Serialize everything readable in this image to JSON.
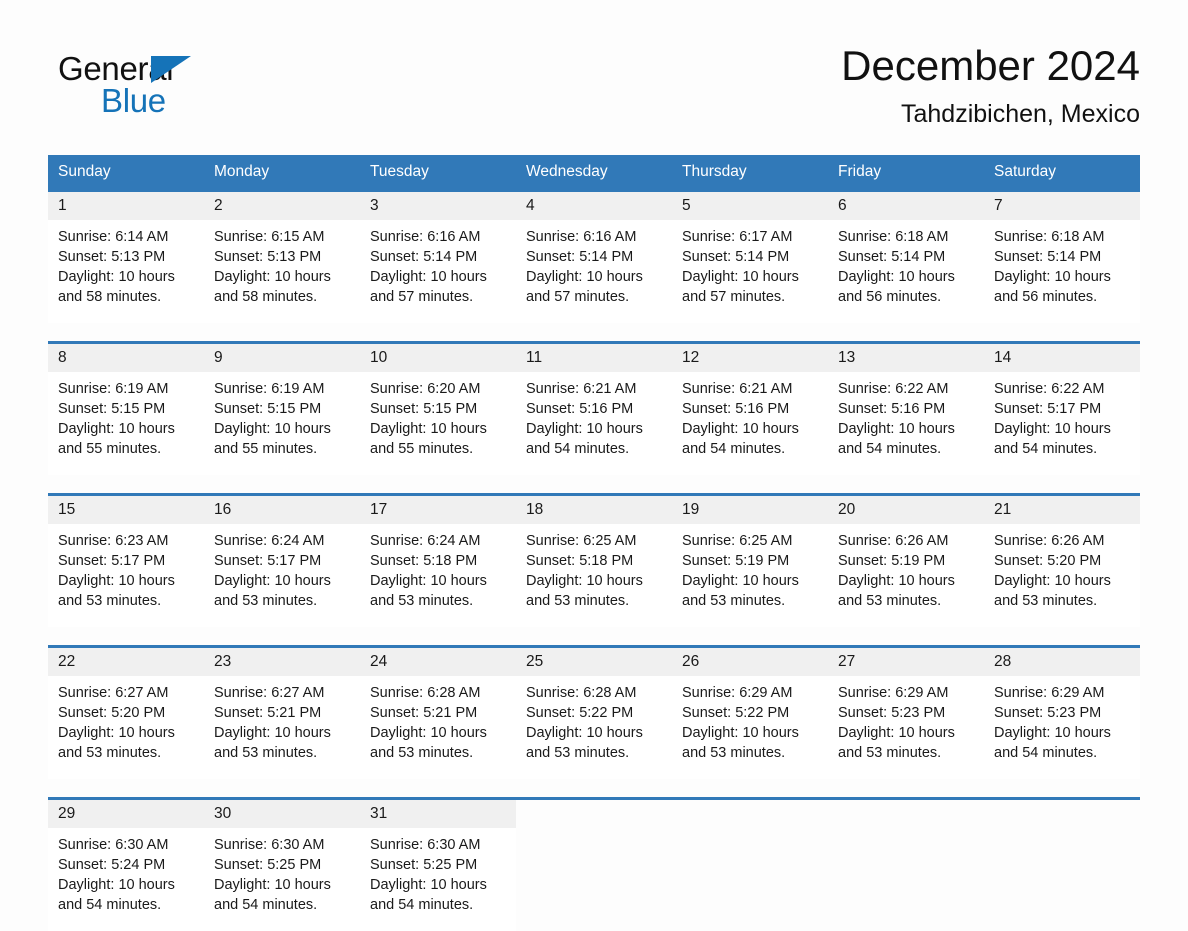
{
  "brand": {
    "word_one": "General",
    "word_two": "Blue",
    "triangle_icon": "brand-triangle-icon",
    "accent_color": "#1573b8"
  },
  "header": {
    "month_title": "December 2024",
    "location": "Tahdzibichen, Mexico"
  },
  "theme": {
    "header_blue": "#3179b8",
    "daynum_band": "#f0f0f0",
    "page_bg": "#fdfdfd",
    "text": "#1a1a1a"
  },
  "calendar": {
    "weekday_headers": [
      "Sunday",
      "Monday",
      "Tuesday",
      "Wednesday",
      "Thursday",
      "Friday",
      "Saturday"
    ],
    "weeks": [
      [
        {
          "day": "1",
          "sunrise": "Sunrise: 6:14 AM",
          "sunset": "Sunset: 5:13 PM",
          "daylight_l1": "Daylight: 10 hours",
          "daylight_l2": "and 58 minutes."
        },
        {
          "day": "2",
          "sunrise": "Sunrise: 6:15 AM",
          "sunset": "Sunset: 5:13 PM",
          "daylight_l1": "Daylight: 10 hours",
          "daylight_l2": "and 58 minutes."
        },
        {
          "day": "3",
          "sunrise": "Sunrise: 6:16 AM",
          "sunset": "Sunset: 5:14 PM",
          "daylight_l1": "Daylight: 10 hours",
          "daylight_l2": "and 57 minutes."
        },
        {
          "day": "4",
          "sunrise": "Sunrise: 6:16 AM",
          "sunset": "Sunset: 5:14 PM",
          "daylight_l1": "Daylight: 10 hours",
          "daylight_l2": "and 57 minutes."
        },
        {
          "day": "5",
          "sunrise": "Sunrise: 6:17 AM",
          "sunset": "Sunset: 5:14 PM",
          "daylight_l1": "Daylight: 10 hours",
          "daylight_l2": "and 57 minutes."
        },
        {
          "day": "6",
          "sunrise": "Sunrise: 6:18 AM",
          "sunset": "Sunset: 5:14 PM",
          "daylight_l1": "Daylight: 10 hours",
          "daylight_l2": "and 56 minutes."
        },
        {
          "day": "7",
          "sunrise": "Sunrise: 6:18 AM",
          "sunset": "Sunset: 5:14 PM",
          "daylight_l1": "Daylight: 10 hours",
          "daylight_l2": "and 56 minutes."
        }
      ],
      [
        {
          "day": "8",
          "sunrise": "Sunrise: 6:19 AM",
          "sunset": "Sunset: 5:15 PM",
          "daylight_l1": "Daylight: 10 hours",
          "daylight_l2": "and 55 minutes."
        },
        {
          "day": "9",
          "sunrise": "Sunrise: 6:19 AM",
          "sunset": "Sunset: 5:15 PM",
          "daylight_l1": "Daylight: 10 hours",
          "daylight_l2": "and 55 minutes."
        },
        {
          "day": "10",
          "sunrise": "Sunrise: 6:20 AM",
          "sunset": "Sunset: 5:15 PM",
          "daylight_l1": "Daylight: 10 hours",
          "daylight_l2": "and 55 minutes."
        },
        {
          "day": "11",
          "sunrise": "Sunrise: 6:21 AM",
          "sunset": "Sunset: 5:16 PM",
          "daylight_l1": "Daylight: 10 hours",
          "daylight_l2": "and 54 minutes."
        },
        {
          "day": "12",
          "sunrise": "Sunrise: 6:21 AM",
          "sunset": "Sunset: 5:16 PM",
          "daylight_l1": "Daylight: 10 hours",
          "daylight_l2": "and 54 minutes."
        },
        {
          "day": "13",
          "sunrise": "Sunrise: 6:22 AM",
          "sunset": "Sunset: 5:16 PM",
          "daylight_l1": "Daylight: 10 hours",
          "daylight_l2": "and 54 minutes."
        },
        {
          "day": "14",
          "sunrise": "Sunrise: 6:22 AM",
          "sunset": "Sunset: 5:17 PM",
          "daylight_l1": "Daylight: 10 hours",
          "daylight_l2": "and 54 minutes."
        }
      ],
      [
        {
          "day": "15",
          "sunrise": "Sunrise: 6:23 AM",
          "sunset": "Sunset: 5:17 PM",
          "daylight_l1": "Daylight: 10 hours",
          "daylight_l2": "and 53 minutes."
        },
        {
          "day": "16",
          "sunrise": "Sunrise: 6:24 AM",
          "sunset": "Sunset: 5:17 PM",
          "daylight_l1": "Daylight: 10 hours",
          "daylight_l2": "and 53 minutes."
        },
        {
          "day": "17",
          "sunrise": "Sunrise: 6:24 AM",
          "sunset": "Sunset: 5:18 PM",
          "daylight_l1": "Daylight: 10 hours",
          "daylight_l2": "and 53 minutes."
        },
        {
          "day": "18",
          "sunrise": "Sunrise: 6:25 AM",
          "sunset": "Sunset: 5:18 PM",
          "daylight_l1": "Daylight: 10 hours",
          "daylight_l2": "and 53 minutes."
        },
        {
          "day": "19",
          "sunrise": "Sunrise: 6:25 AM",
          "sunset": "Sunset: 5:19 PM",
          "daylight_l1": "Daylight: 10 hours",
          "daylight_l2": "and 53 minutes."
        },
        {
          "day": "20",
          "sunrise": "Sunrise: 6:26 AM",
          "sunset": "Sunset: 5:19 PM",
          "daylight_l1": "Daylight: 10 hours",
          "daylight_l2": "and 53 minutes."
        },
        {
          "day": "21",
          "sunrise": "Sunrise: 6:26 AM",
          "sunset": "Sunset: 5:20 PM",
          "daylight_l1": "Daylight: 10 hours",
          "daylight_l2": "and 53 minutes."
        }
      ],
      [
        {
          "day": "22",
          "sunrise": "Sunrise: 6:27 AM",
          "sunset": "Sunset: 5:20 PM",
          "daylight_l1": "Daylight: 10 hours",
          "daylight_l2": "and 53 minutes."
        },
        {
          "day": "23",
          "sunrise": "Sunrise: 6:27 AM",
          "sunset": "Sunset: 5:21 PM",
          "daylight_l1": "Daylight: 10 hours",
          "daylight_l2": "and 53 minutes."
        },
        {
          "day": "24",
          "sunrise": "Sunrise: 6:28 AM",
          "sunset": "Sunset: 5:21 PM",
          "daylight_l1": "Daylight: 10 hours",
          "daylight_l2": "and 53 minutes."
        },
        {
          "day": "25",
          "sunrise": "Sunrise: 6:28 AM",
          "sunset": "Sunset: 5:22 PM",
          "daylight_l1": "Daylight: 10 hours",
          "daylight_l2": "and 53 minutes."
        },
        {
          "day": "26",
          "sunrise": "Sunrise: 6:29 AM",
          "sunset": "Sunset: 5:22 PM",
          "daylight_l1": "Daylight: 10 hours",
          "daylight_l2": "and 53 minutes."
        },
        {
          "day": "27",
          "sunrise": "Sunrise: 6:29 AM",
          "sunset": "Sunset: 5:23 PM",
          "daylight_l1": "Daylight: 10 hours",
          "daylight_l2": "and 53 minutes."
        },
        {
          "day": "28",
          "sunrise": "Sunrise: 6:29 AM",
          "sunset": "Sunset: 5:23 PM",
          "daylight_l1": "Daylight: 10 hours",
          "daylight_l2": "and 54 minutes."
        }
      ],
      [
        {
          "day": "29",
          "sunrise": "Sunrise: 6:30 AM",
          "sunset": "Sunset: 5:24 PM",
          "daylight_l1": "Daylight: 10 hours",
          "daylight_l2": "and 54 minutes."
        },
        {
          "day": "30",
          "sunrise": "Sunrise: 6:30 AM",
          "sunset": "Sunset: 5:25 PM",
          "daylight_l1": "Daylight: 10 hours",
          "daylight_l2": "and 54 minutes."
        },
        {
          "day": "31",
          "sunrise": "Sunrise: 6:30 AM",
          "sunset": "Sunset: 5:25 PM",
          "daylight_l1": "Daylight: 10 hours",
          "daylight_l2": "and 54 minutes."
        },
        {
          "day": "",
          "sunrise": "",
          "sunset": "",
          "daylight_l1": "",
          "daylight_l2": ""
        },
        {
          "day": "",
          "sunrise": "",
          "sunset": "",
          "daylight_l1": "",
          "daylight_l2": ""
        },
        {
          "day": "",
          "sunrise": "",
          "sunset": "",
          "daylight_l1": "",
          "daylight_l2": ""
        },
        {
          "day": "",
          "sunrise": "",
          "sunset": "",
          "daylight_l1": "",
          "daylight_l2": ""
        }
      ]
    ]
  }
}
